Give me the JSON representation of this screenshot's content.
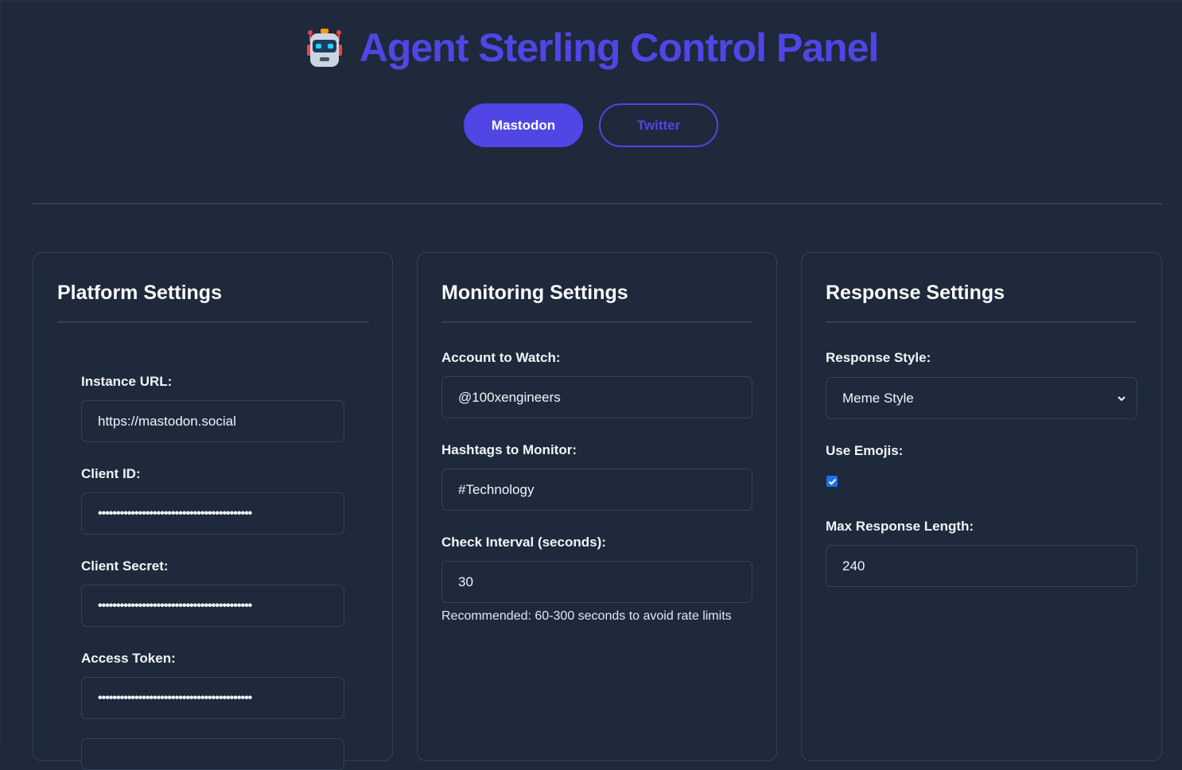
{
  "header": {
    "title": "Agent Sterling Control Panel",
    "logo_icon": "robot-icon"
  },
  "platform_tabs": [
    {
      "label": "Mastodon",
      "active": true
    },
    {
      "label": "Twitter",
      "active": false
    }
  ],
  "colors": {
    "accent": "#4f46e5",
    "background": "#1e293b",
    "border": "#334155",
    "checkbox": "#1a73e8"
  },
  "platform_settings": {
    "title": "Platform Settings",
    "instance_url_label": "Instance URL:",
    "instance_url_value": "https://mastodon.social",
    "client_id_label": "Client ID:",
    "client_id_value": "••••••••••••••••••••••••••••••••••••••••••",
    "client_secret_label": "Client Secret:",
    "client_secret_value": "••••••••••••••••••••••••••••••••••••••••••",
    "access_token_label": "Access Token:",
    "access_token_value": "••••••••••••••••••••••••••••••••••••••••••"
  },
  "monitoring_settings": {
    "title": "Monitoring Settings",
    "account_label": "Account to Watch:",
    "account_value": "@100xengineers",
    "hashtags_label": "Hashtags to Monitor:",
    "hashtags_value": "#Technology",
    "interval_label": "Check Interval (seconds):",
    "interval_value": "30",
    "interval_help": "Recommended: 60-300 seconds to avoid rate limits"
  },
  "response_settings": {
    "title": "Response Settings",
    "style_label": "Response Style:",
    "style_value": "Meme Style",
    "emojis_label": "Use Emojis:",
    "emojis_checked": true,
    "max_length_label": "Max Response Length:",
    "max_length_value": "240"
  }
}
